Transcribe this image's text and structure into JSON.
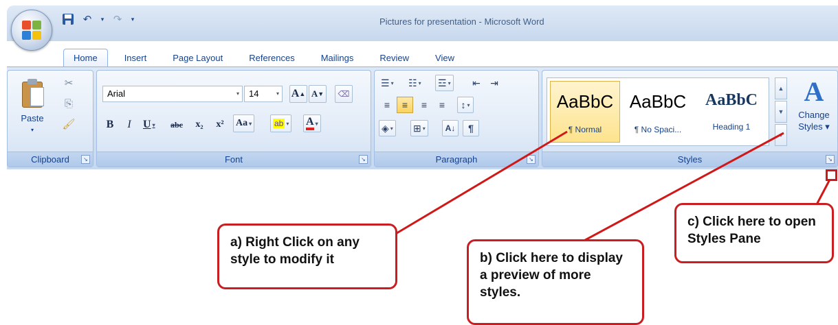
{
  "title_bar": {
    "window_title": "Pictures for presentation - Microsoft Word",
    "office_button_icon": "office-logo-icon",
    "quick_access": [
      {
        "icon": "save-icon",
        "glyph": "🖫"
      },
      {
        "icon": "undo-icon",
        "glyph": "↶"
      },
      {
        "icon": "redo-icon",
        "glyph": "↷"
      }
    ]
  },
  "tabs": [
    {
      "label": "Home",
      "active": true
    },
    {
      "label": "Insert"
    },
    {
      "label": "Page Layout"
    },
    {
      "label": "References"
    },
    {
      "label": "Mailings"
    },
    {
      "label": "Review"
    },
    {
      "label": "View"
    }
  ],
  "clipboard": {
    "label": "Clipboard",
    "paste_label": "Paste",
    "cut_icon": "✂",
    "copy_icon": "⎘",
    "format_painter_icon": "🖌"
  },
  "font": {
    "label": "Font",
    "font_name": "Arial",
    "font_size": "14",
    "grow_font": "A",
    "shrink_font": "A",
    "bold": "B",
    "italic": "I",
    "underline": "U",
    "strikethrough": "abc",
    "subscript": "x₂",
    "superscript": "x²",
    "change_case": "Aa",
    "highlight": "ab",
    "font_color": "A"
  },
  "paragraph": {
    "label": "Paragraph",
    "bullets": "☰",
    "numbering": "☷",
    "multilevel": "☲",
    "decrease_indent": "⇤",
    "increase_indent": "⇥",
    "align_left": "≡",
    "align_center": "≡",
    "align_right": "≡",
    "justify": "≡",
    "line_spacing": "↕",
    "shading": "◈",
    "borders": "⊞",
    "sort": "A↓",
    "show_marks": "¶"
  },
  "styles": {
    "label": "Styles",
    "tiles": [
      {
        "preview": "AaBbC",
        "name": "¶ Normal",
        "selected": true
      },
      {
        "preview": "AaBbC",
        "name": "¶ No Spaci..."
      },
      {
        "preview": "AaBbC",
        "name": "Heading 1"
      }
    ],
    "change_styles_icon": "A",
    "change_styles_label_1": "Change",
    "change_styles_label_2": "Styles"
  },
  "callouts": {
    "a": "a) Right Click on any style to modify it",
    "b": "b) Click here to display a preview of more styles.",
    "c": "c) Click here to open Styles Pane"
  },
  "colors": {
    "callout_border": "#c81e22",
    "ribbon_text": "#15428b"
  }
}
